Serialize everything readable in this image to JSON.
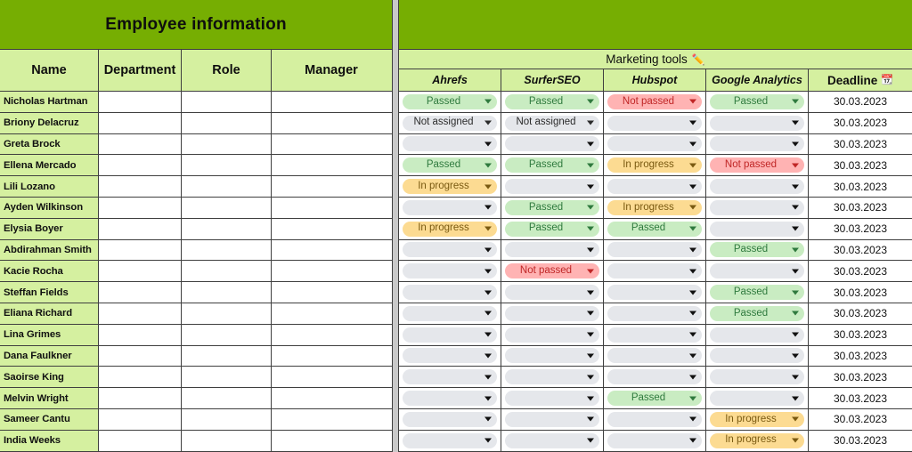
{
  "left": {
    "banner_title": "Employee information",
    "columns": [
      "Name",
      "Department",
      "Role",
      "Manager"
    ]
  },
  "right": {
    "group_label": "Marketing tools",
    "group_icon": "pencil-icon",
    "group_icon_glyph": "✏️",
    "deadline_icon": "calendar-icon",
    "deadline_icon_glyph": "📆",
    "columns": [
      "Ahrefs",
      "SurferSEO",
      "Hubspot",
      "Google Analytics"
    ],
    "deadline_label": "Deadline"
  },
  "status_colors": {
    "passed_bg": "#c9ecc2",
    "passed_text": "#2f7a3e",
    "not_passed_bg": "#ffb3b3",
    "not_passed_text": "#c02626",
    "in_progress_bg": "#fcdb92",
    "in_progress_text": "#7a5a11",
    "empty_bg": "#e5e7eb",
    "header_green": "#76ae02",
    "header_light_green": "#d5f0a0"
  },
  "rows": [
    {
      "name": "Nicholas Hartman",
      "department": "",
      "role": "",
      "manager": "",
      "ahrefs": "Passed",
      "surferseo": "Passed",
      "hubspot": "Not passed",
      "google_analytics": "Passed",
      "deadline": "30.03.2023"
    },
    {
      "name": "Briony Delacruz",
      "department": "",
      "role": "",
      "manager": "",
      "ahrefs": "Not assigned",
      "surferseo": "Not assigned",
      "hubspot": "",
      "google_analytics": "",
      "deadline": "30.03.2023"
    },
    {
      "name": "Greta Brock",
      "department": "",
      "role": "",
      "manager": "",
      "ahrefs": "",
      "surferseo": "",
      "hubspot": "",
      "google_analytics": "",
      "deadline": "30.03.2023"
    },
    {
      "name": "Ellena Mercado",
      "department": "",
      "role": "",
      "manager": "",
      "ahrefs": "Passed",
      "surferseo": "Passed",
      "hubspot": "In progress",
      "google_analytics": "Not passed",
      "deadline": "30.03.2023"
    },
    {
      "name": "Lili Lozano",
      "department": "",
      "role": "",
      "manager": "",
      "ahrefs": "In progress",
      "surferseo": "",
      "hubspot": "",
      "google_analytics": "",
      "deadline": "30.03.2023"
    },
    {
      "name": "Ayden Wilkinson",
      "department": "",
      "role": "",
      "manager": "",
      "ahrefs": "",
      "surferseo": "Passed",
      "hubspot": "In progress",
      "google_analytics": "",
      "deadline": "30.03.2023"
    },
    {
      "name": "Elysia Boyer",
      "department": "",
      "role": "",
      "manager": "",
      "ahrefs": "In progress",
      "surferseo": "Passed",
      "hubspot": "Passed",
      "google_analytics": "",
      "deadline": "30.03.2023"
    },
    {
      "name": "Abdirahman Smith",
      "department": "",
      "role": "",
      "manager": "",
      "ahrefs": "",
      "surferseo": "",
      "hubspot": "",
      "google_analytics": "Passed",
      "deadline": "30.03.2023"
    },
    {
      "name": "Kacie Rocha",
      "department": "",
      "role": "",
      "manager": "",
      "ahrefs": "",
      "surferseo": "Not passed",
      "hubspot": "",
      "google_analytics": "",
      "deadline": "30.03.2023"
    },
    {
      "name": "Steffan Fields",
      "department": "",
      "role": "",
      "manager": "",
      "ahrefs": "",
      "surferseo": "",
      "hubspot": "",
      "google_analytics": "Passed",
      "deadline": "30.03.2023"
    },
    {
      "name": "Eliana Richard",
      "department": "",
      "role": "",
      "manager": "",
      "ahrefs": "",
      "surferseo": "",
      "hubspot": "",
      "google_analytics": "Passed",
      "deadline": "30.03.2023"
    },
    {
      "name": "Lina Grimes",
      "department": "",
      "role": "",
      "manager": "",
      "ahrefs": "",
      "surferseo": "",
      "hubspot": "",
      "google_analytics": "",
      "deadline": "30.03.2023"
    },
    {
      "name": "Dana Faulkner",
      "department": "",
      "role": "",
      "manager": "",
      "ahrefs": "",
      "surferseo": "",
      "hubspot": "",
      "google_analytics": "",
      "deadline": "30.03.2023"
    },
    {
      "name": "Saoirse King",
      "department": "",
      "role": "",
      "manager": "",
      "ahrefs": "",
      "surferseo": "",
      "hubspot": "",
      "google_analytics": "",
      "deadline": "30.03.2023"
    },
    {
      "name": "Melvin Wright",
      "department": "",
      "role": "",
      "manager": "",
      "ahrefs": "",
      "surferseo": "",
      "hubspot": "Passed",
      "google_analytics": "",
      "deadline": "30.03.2023"
    },
    {
      "name": "Sameer Cantu",
      "department": "",
      "role": "",
      "manager": "",
      "ahrefs": "",
      "surferseo": "",
      "hubspot": "",
      "google_analytics": "In progress",
      "deadline": "30.03.2023"
    },
    {
      "name": "India Weeks",
      "department": "",
      "role": "",
      "manager": "",
      "ahrefs": "",
      "surferseo": "",
      "hubspot": "",
      "google_analytics": "In progress",
      "deadline": "30.03.2023"
    }
  ]
}
